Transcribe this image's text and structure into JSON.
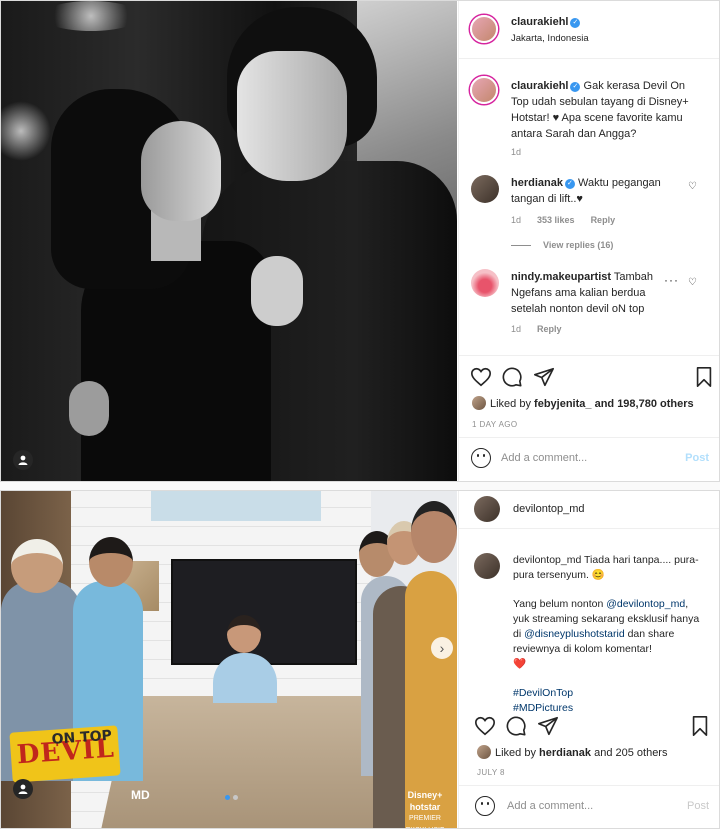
{
  "post1": {
    "author": "claurakiehl",
    "location": "Jakarta, Indonesia",
    "caption": "Gak kerasa Devil On Top udah sebulan tayang di Disney+ Hotstar! ♥ Apa scene favorite kamu antara Sarah dan Angga?",
    "caption_time": "1d",
    "comments": [
      {
        "user": "herdianak",
        "verified": true,
        "text": "Waktu pegangan tangan di lift..♥",
        "time": "1d",
        "likes": "353 likes",
        "reply": "Reply",
        "view_replies": "View replies (16)"
      },
      {
        "user": "nindy.makeupartist",
        "verified": false,
        "text": "Tambah Ngefans ama kalian berdua setelah nonton devil oN top",
        "time": "1d",
        "reply": "Reply"
      }
    ],
    "liked_by_prefix": "Liked by",
    "liked_by_user": "febyjenita_",
    "liked_by_suffix": "and 198,780 others",
    "date": "1 DAY AGO",
    "add_comment_placeholder": "Add a comment...",
    "post_label": "Post"
  },
  "post2": {
    "author": "devilontop_md",
    "caption_line1": "Tiada hari tanpa.... pura-pura tersenyum. 😊",
    "caption_line2_prefix": "Yang belum nonton",
    "caption_mention1": "@devilontop_md",
    "caption_line2_mid": ", yuk streaming sekarang eksklusif hanya di",
    "caption_mention2": "@disneyplushotstarid",
    "caption_line2_suffix": "dan share reviewnya di kolom komentar!",
    "caption_heart": "❤️",
    "hashtag1": "#DevilOnTop",
    "hashtag2": "#MDPictures",
    "liked_by_prefix": "Liked by",
    "liked_by_user": "herdianak",
    "liked_by_suffix": "and 205 others",
    "date": "JULY 8",
    "add_comment_placeholder": "Add a comment...",
    "post_label": "Post",
    "poster_title": "DEVIL",
    "poster_top": "ON TOP",
    "md_logo": "MD",
    "hotstar_brand": "Disney+ hotstar",
    "hotstar_sub": "PREMIER EKSKLUSIF"
  },
  "icons": [
    "heart-icon",
    "comment-icon",
    "share-icon",
    "bookmark-icon",
    "emoji-icon",
    "user-tag-icon",
    "more-icon",
    "verified-icon",
    "chevron-right-icon"
  ],
  "colors": {
    "verified": "#3897f0",
    "link": "#00376b",
    "post_disabled": "#b2dffc",
    "story_ring": "#d6249f"
  }
}
